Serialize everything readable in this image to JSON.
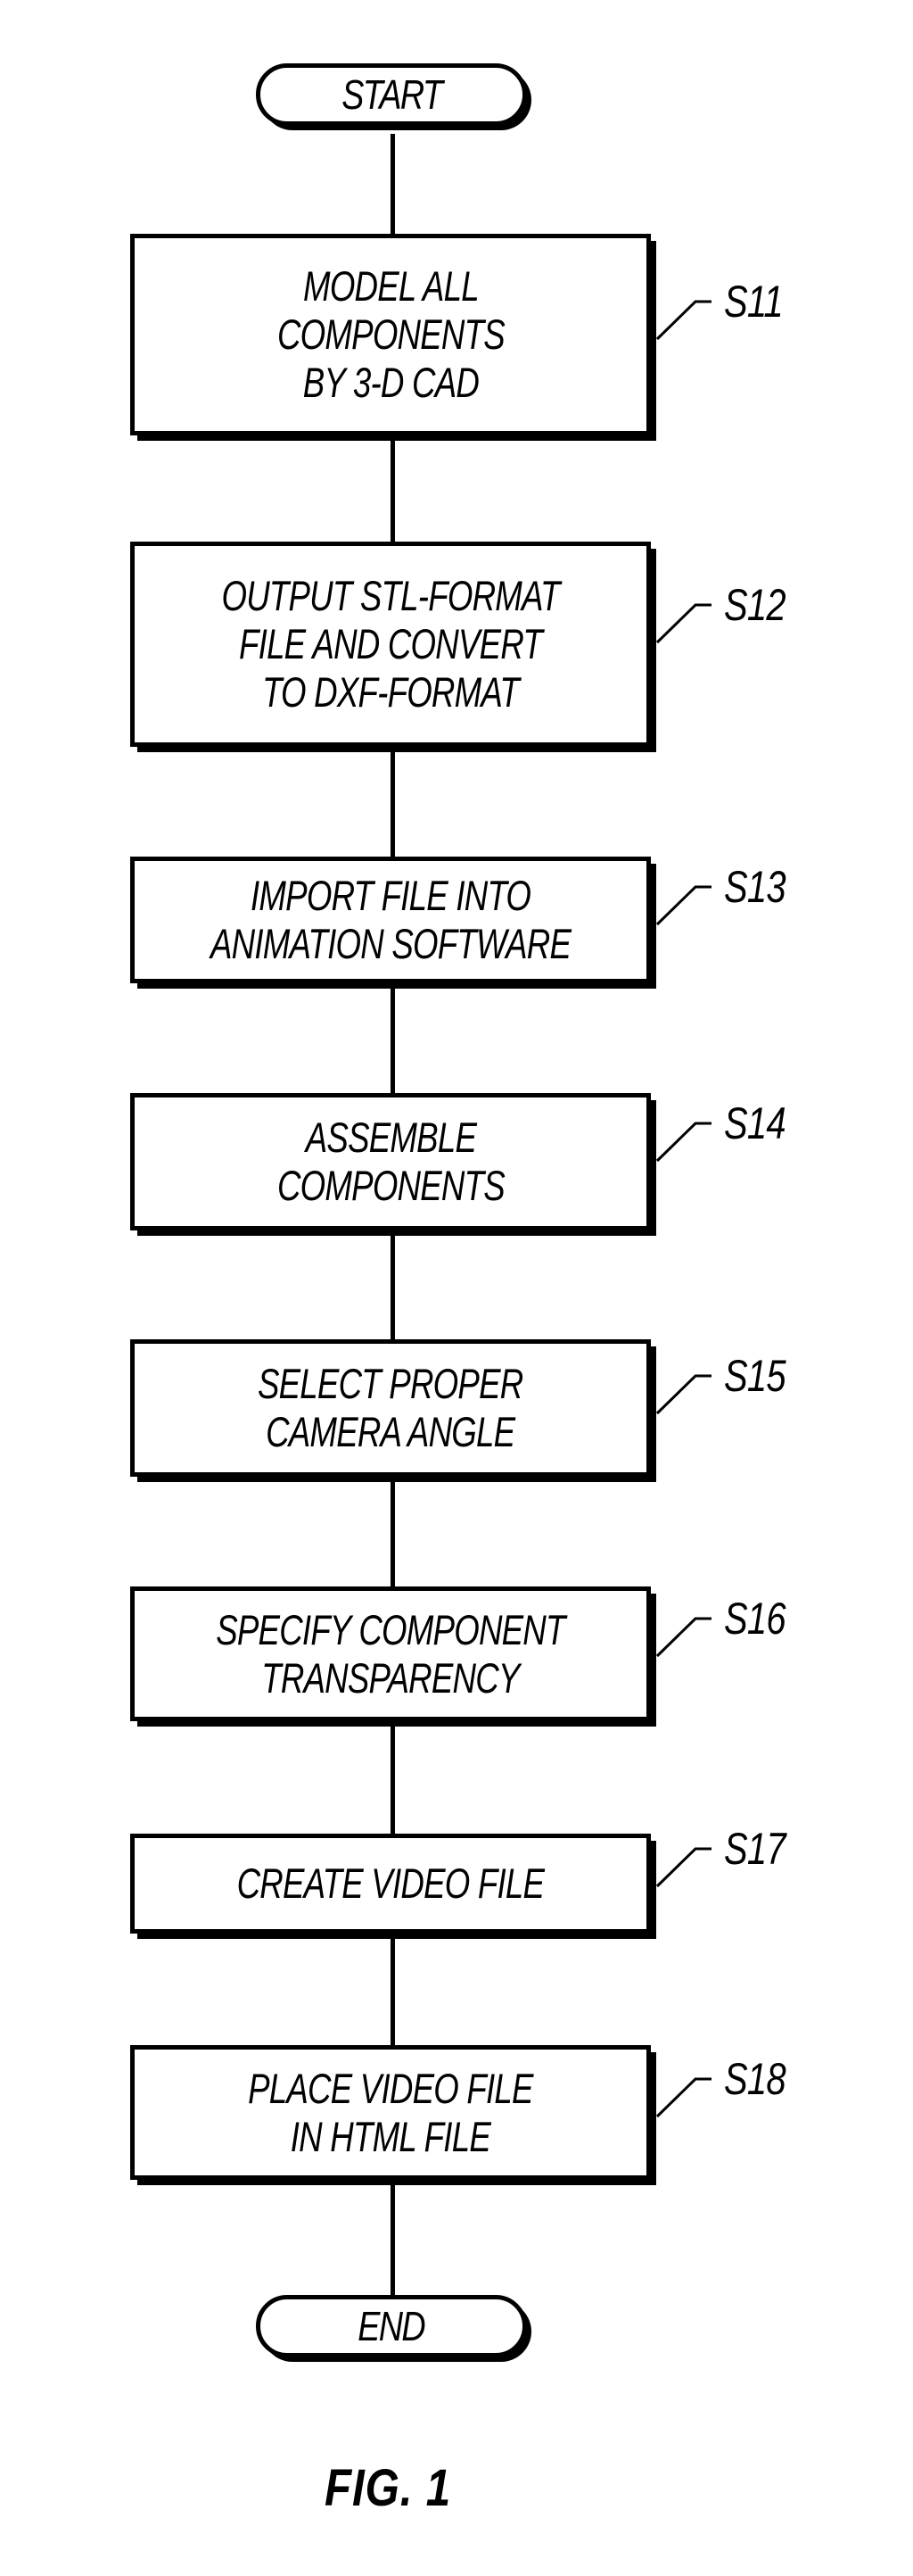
{
  "diagram": {
    "type": "flowchart",
    "figure_caption": "FIG. 1",
    "start_label": "START",
    "end_label": "END",
    "steps": [
      {
        "id": "S11",
        "lines": [
          "MODEL ALL",
          "COMPONENTS",
          "BY 3-D CAD"
        ]
      },
      {
        "id": "S12",
        "lines": [
          "OUTPUT STL-FORMAT",
          "FILE AND CONVERT",
          "TO DXF-FORMAT"
        ]
      },
      {
        "id": "S13",
        "lines": [
          "IMPORT FILE INTO",
          "ANIMATION SOFTWARE"
        ]
      },
      {
        "id": "S14",
        "lines": [
          "ASSEMBLE",
          "COMPONENTS"
        ]
      },
      {
        "id": "S15",
        "lines": [
          "SELECT PROPER",
          "CAMERA ANGLE"
        ]
      },
      {
        "id": "S16",
        "lines": [
          "SPECIFY COMPONENT",
          "TRANSPARENCY"
        ]
      },
      {
        "id": "S17",
        "lines": [
          "CREATE VIDEO FILE"
        ]
      },
      {
        "id": "S18",
        "lines": [
          "PLACE VIDEO FILE",
          "IN HTML FILE"
        ]
      }
    ],
    "colors": {
      "ink": "#000000",
      "background": "#ffffff"
    }
  }
}
